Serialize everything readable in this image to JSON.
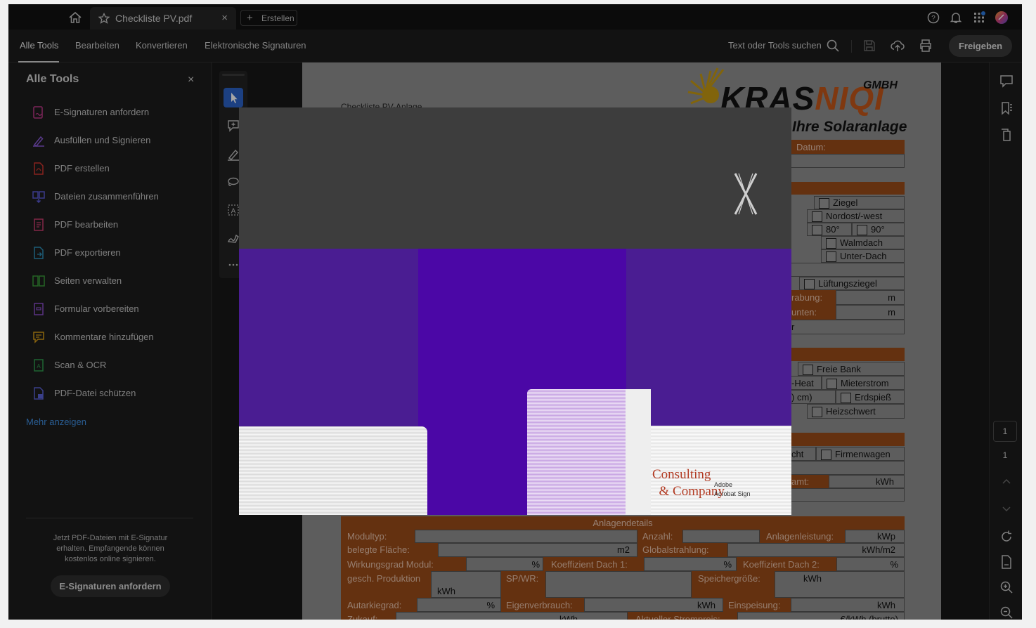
{
  "tab": {
    "title": "Checkliste PV.pdf",
    "close": "×"
  },
  "create_button": "Erstellen",
  "menu": {
    "items": [
      "Alle Tools",
      "Bearbeiten",
      "Konvertieren",
      "Elektronische Signaturen"
    ],
    "search": "Text oder Tools suchen",
    "share": "Freigeben"
  },
  "left_panel": {
    "title": "Alle Tools",
    "close": "×",
    "tools": [
      {
        "label": "E-Signaturen anfordern",
        "icon": "esign-request-icon",
        "color": "#c0398b"
      },
      {
        "label": "Ausfüllen und Signieren",
        "icon": "fill-sign-icon",
        "color": "#8a5ad8"
      },
      {
        "label": "PDF erstellen",
        "icon": "create-pdf-icon",
        "color": "#d1372f"
      },
      {
        "label": "Dateien zusammenführen",
        "icon": "combine-files-icon",
        "color": "#5b5bd6"
      },
      {
        "label": "PDF bearbeiten",
        "icon": "edit-pdf-icon",
        "color": "#c93c6e"
      },
      {
        "label": "PDF exportieren",
        "icon": "export-pdf-icon",
        "color": "#2d8fb8"
      },
      {
        "label": "Seiten verwalten",
        "icon": "organize-pages-icon",
        "color": "#3a9a3a"
      },
      {
        "label": "Formular vorbereiten",
        "icon": "prepare-form-icon",
        "color": "#8a4fc9"
      },
      {
        "label": "Kommentare hinzufügen",
        "icon": "comment-icon",
        "color": "#d49a16"
      },
      {
        "label": "Scan & OCR",
        "icon": "scan-ocr-icon",
        "color": "#2e9a4e"
      },
      {
        "label": "PDF-Datei schützen",
        "icon": "protect-pdf-icon",
        "color": "#5a62d4"
      }
    ],
    "more": "Mehr anzeigen",
    "promo_text": "Jetzt PDF-Dateien mit E-Signatur erhalten. Empfangende können kostenlos online signieren.",
    "promo_button": "E-Signaturen anfordern"
  },
  "document": {
    "logo": {
      "part1": "KRAS",
      "part2": "NIQI",
      "gmbh": "GMBH",
      "subtitle": "Ihre Solaranlage"
    },
    "heading": "Checkliste PV-Anlage",
    "date_label": "Datum:",
    "right_col": [
      {
        "text": "Ziegel",
        "checkbox": true
      },
      {
        "text": "Nordost/-west",
        "checkbox": true
      },
      {
        "text": "80°",
        "checkbox": true
      },
      {
        "text": "90°",
        "checkbox": true
      },
      {
        "text": "Walmdach",
        "checkbox": true
      },
      {
        "text": "Unter-Dach",
        "checkbox": true
      },
      {
        "text": "Lüftungsziegel",
        "checkbox": true
      },
      {
        "text": "Freie Bank",
        "checkbox": true
      },
      {
        "text": "Mieterstrom",
        "checkbox": true
      },
      {
        "text": "Erdspieß",
        "checkbox": true
      },
      {
        "text": "Heizschwert",
        "checkbox": true
      },
      {
        "text": "Firmenwagen",
        "checkbox": true
      }
    ],
    "partial": {
      "rabung": "rabung:",
      "unten": "unten:",
      "r": "r",
      "heat": "-Heat",
      "cm": ") cm)",
      "cht": "cht",
      "amt": "amt:",
      "m": "m",
      "kwh": "kWh"
    },
    "anlagen": {
      "header": "Anlagendetails",
      "modultyp": "Modultyp:",
      "anzahl": "Anzahl:",
      "anlagenleistung": "Anlagenleistung:",
      "kwp": "kWp",
      "flaeche": "belegte Fläche:",
      "m2": "m2",
      "globalstrahlung": "Globalstrahlung:",
      "kwhm2": "kWh/m2",
      "wirkungsgrad": "Wirkungsgrad Modul:",
      "percent": "%",
      "koeff1": "Koeffizient Dach 1:",
      "koeff2": "Koeffizient Dach 2:",
      "produktion": "gesch. Produktion",
      "kwh": "kWh",
      "spwr": "SP/WR:",
      "speicher": "Speichergröße:",
      "autarkie": "Autarkiegrad:",
      "eigenverbrauch": "Eigenverbrauch:",
      "einspeisung": "Einspeisung:",
      "zukauf": "Zukauf:",
      "strompreis": "Aktueller Strompreis:",
      "brutto": "€/kWh (brutto)"
    }
  },
  "right_bar": {
    "page_current": "1",
    "page_total": "1"
  },
  "modal": {
    "close_glyph": "X",
    "ad": {
      "consulting": "Consulting",
      "company": "& Company",
      "adobe1": "Adobe",
      "adobe2": "Acrobat Sign"
    },
    "colors": {
      "ad_bg": "#4a1d92",
      "ad_center": "#4b07a6"
    }
  }
}
